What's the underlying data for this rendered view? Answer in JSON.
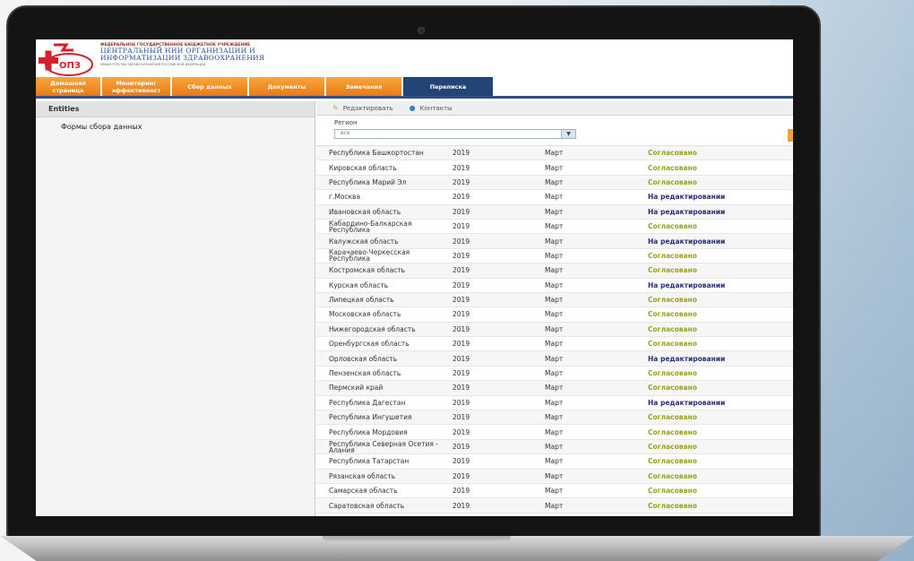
{
  "colors": {
    "tab_orange": "#ea7a12",
    "tab_active": "#234476",
    "status_ok": "#9aa21a",
    "status_edit": "#2a2e7a"
  },
  "header": {
    "org_sub": "ФЕДЕРАЛЬНОЕ ГОСУДАРСТВЕННОЕ БЮДЖЕТНОЕ УЧРЕЖДЕНИЕ",
    "org_line1": "ЦЕНТРАЛЬНЫЙ НИИ ОРГАНИЗАЦИИ И",
    "org_line2": "ИНФОРМАТИЗАЦИИ ЗДРАВООХРАНЕНИЯ",
    "ministry": "МИНИСТЕРСТВА ЗДРАВООХРАНЕНИЯ РОССИЙСКОЙ ФЕДЕРАЦИИ",
    "logo_text": "ОПЗ"
  },
  "tabs": [
    {
      "label": "Домашняя страница",
      "active": false
    },
    {
      "label": "Мониторинг эффективност",
      "active": false
    },
    {
      "label": "Сбор данных",
      "active": false
    },
    {
      "label": "Документы",
      "active": false
    },
    {
      "label": "Замечания",
      "active": false
    },
    {
      "label": "Переписка",
      "active": true
    }
  ],
  "sidebar": {
    "header": "Entities",
    "items": [
      "Формы сбора данных"
    ]
  },
  "toolbar": {
    "edit_label": "Редактировать",
    "contacts_label": "Контакты"
  },
  "filter": {
    "label": "Регион",
    "value": "все"
  },
  "rows": [
    {
      "region": "Республика Башкортостан",
      "year": "2019",
      "month": "Март",
      "status": "Согласовано",
      "type": "ok"
    },
    {
      "region": "Кировская область",
      "year": "2019",
      "month": "Март",
      "status": "Согласовано",
      "type": "ok"
    },
    {
      "region": "Республика Марий Эл",
      "year": "2019",
      "month": "Март",
      "status": "Согласовано",
      "type": "ok"
    },
    {
      "region": "г.Москва",
      "year": "2019",
      "month": "Март",
      "status": "На редактировании",
      "type": "edit"
    },
    {
      "region": "Ивановская область",
      "year": "2019",
      "month": "Март",
      "status": "На редактировании",
      "type": "edit"
    },
    {
      "region": "Кабардино-Балкарская Республика",
      "year": "2019",
      "month": "Март",
      "status": "Согласовано",
      "type": "ok"
    },
    {
      "region": "Калужская область",
      "year": "2019",
      "month": "Март",
      "status": "На редактировании",
      "type": "edit"
    },
    {
      "region": "Карачаево-Черкесская Республика",
      "year": "2019",
      "month": "Март",
      "status": "Согласовано",
      "type": "ok"
    },
    {
      "region": "Костромская область",
      "year": "2019",
      "month": "Март",
      "status": "Согласовано",
      "type": "ok"
    },
    {
      "region": "Курская область",
      "year": "2019",
      "month": "Март",
      "status": "На редактировании",
      "type": "edit"
    },
    {
      "region": "Липецкая область",
      "year": "2019",
      "month": "Март",
      "status": "Согласовано",
      "type": "ok"
    },
    {
      "region": "Московская область",
      "year": "2019",
      "month": "Март",
      "status": "Согласовано",
      "type": "ok"
    },
    {
      "region": "Нижегородская область",
      "year": "2019",
      "month": "Март",
      "status": "Согласовано",
      "type": "ok"
    },
    {
      "region": "Оренбургская область",
      "year": "2019",
      "month": "Март",
      "status": "Согласовано",
      "type": "ok"
    },
    {
      "region": "Орловская область",
      "year": "2019",
      "month": "Март",
      "status": "На редактировании",
      "type": "edit"
    },
    {
      "region": "Пензенская область",
      "year": "2019",
      "month": "Март",
      "status": "Согласовано",
      "type": "ok"
    },
    {
      "region": "Пермский край",
      "year": "2019",
      "month": "Март",
      "status": "Согласовано",
      "type": "ok"
    },
    {
      "region": "Республика Дагестан",
      "year": "2019",
      "month": "Март",
      "status": "На редактировании",
      "type": "edit"
    },
    {
      "region": "Республика Ингушетия",
      "year": "2019",
      "month": "Март",
      "status": "Согласовано",
      "type": "ok"
    },
    {
      "region": "Республика Мордовия",
      "year": "2019",
      "month": "Март",
      "status": "Согласовано",
      "type": "ok"
    },
    {
      "region": "Республика Северная Осетия - Алания",
      "year": "2019",
      "month": "Март",
      "status": "Согласовано",
      "type": "ok"
    },
    {
      "region": "Республика Татарстан",
      "year": "2019",
      "month": "Март",
      "status": "Согласовано",
      "type": "ok"
    },
    {
      "region": "Рязанская область",
      "year": "2019",
      "month": "Март",
      "status": "Согласовано",
      "type": "ok"
    },
    {
      "region": "Самарская область",
      "year": "2019",
      "month": "Март",
      "status": "Согласовано",
      "type": "ok"
    },
    {
      "region": "Саратовская область",
      "year": "2019",
      "month": "Март",
      "status": "Согласовано",
      "type": "ok"
    }
  ]
}
